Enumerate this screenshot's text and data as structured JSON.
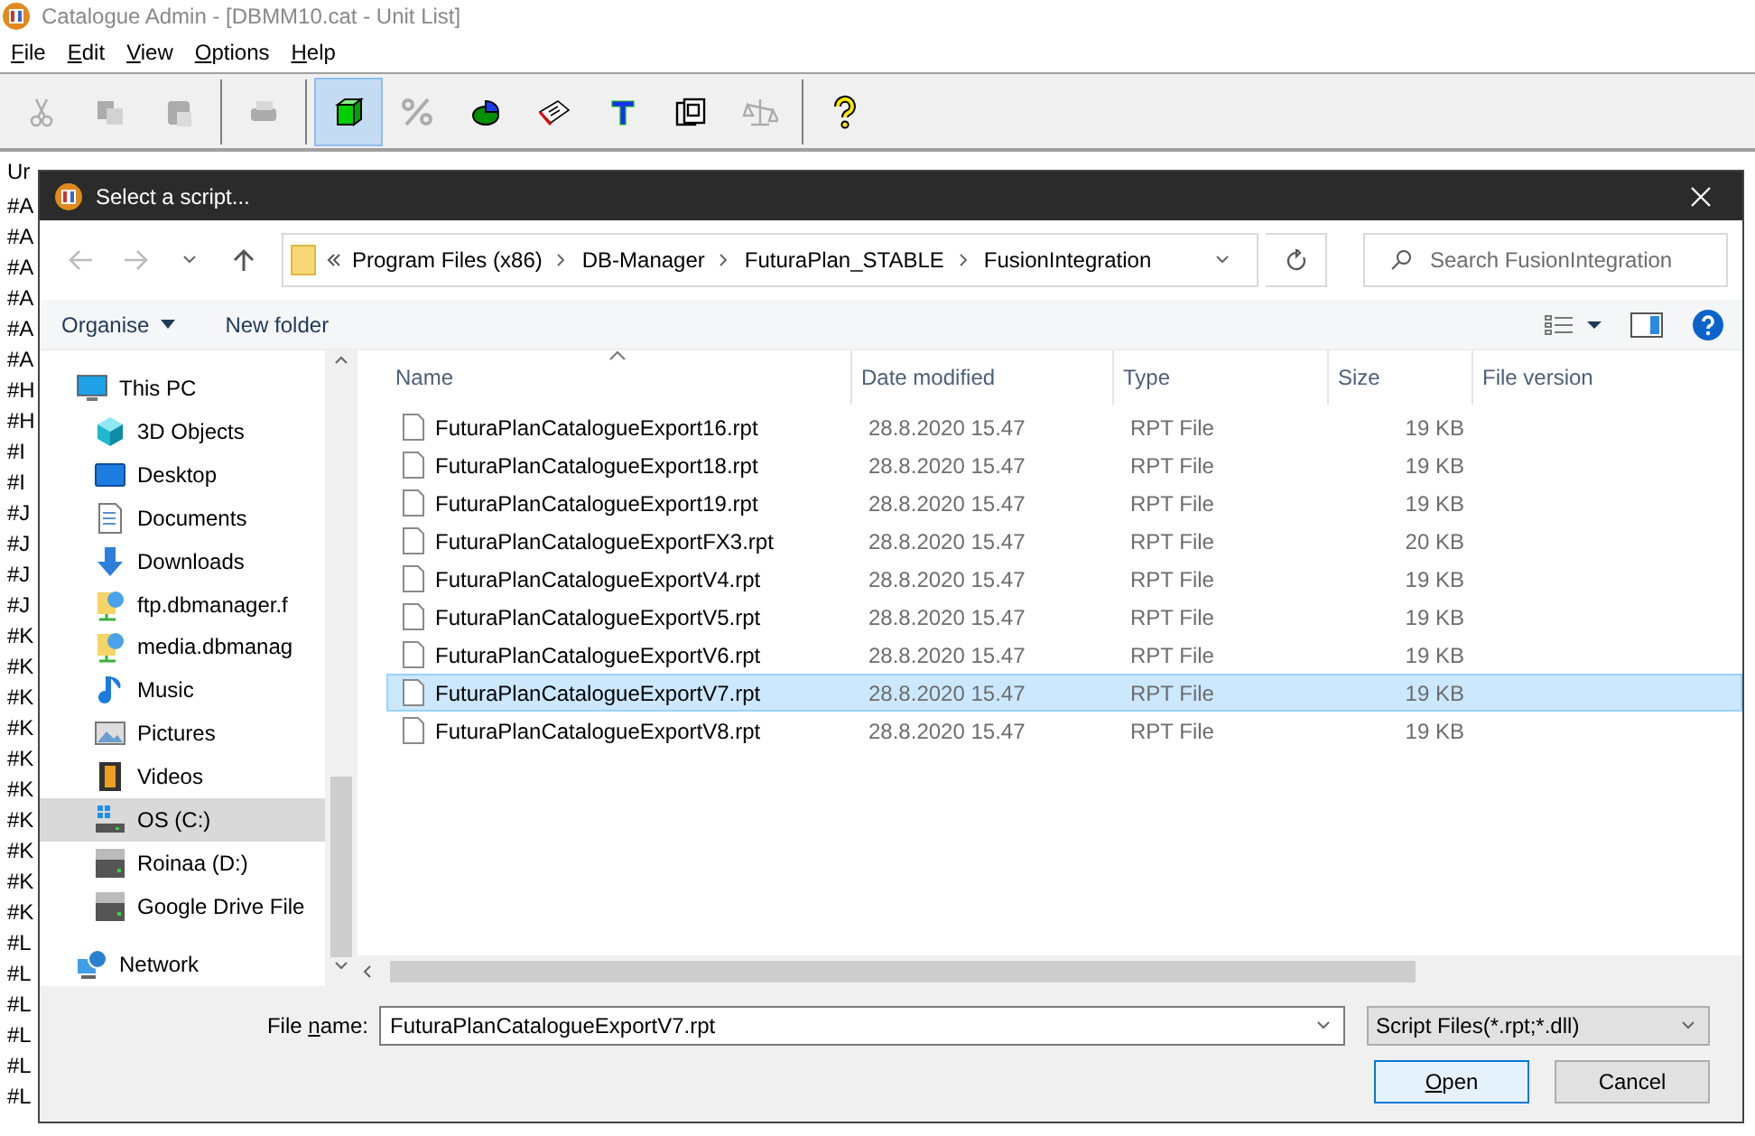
{
  "window": {
    "title": "Catalogue Admin - [DBMM10.cat - Unit List]"
  },
  "menu": [
    "File",
    "Edit",
    "View",
    "Options",
    "Help"
  ],
  "toolbar": [
    {
      "kind": "tool",
      "disabled": true,
      "selected": false
    },
    {
      "kind": "tool",
      "disabled": true,
      "selected": false
    },
    {
      "kind": "tool",
      "disabled": true,
      "selected": false
    },
    {
      "kind": "separator"
    },
    {
      "kind": "tool",
      "disabled": true,
      "selected": false
    },
    {
      "kind": "separator"
    },
    {
      "kind": "tool",
      "disabled": false,
      "selected": true
    },
    {
      "kind": "tool",
      "disabled": true,
      "selected": false
    },
    {
      "kind": "tool",
      "disabled": false,
      "selected": false
    },
    {
      "kind": "tool",
      "disabled": false,
      "selected": false
    },
    {
      "kind": "tool",
      "disabled": false,
      "selected": false
    },
    {
      "kind": "tool",
      "disabled": false,
      "selected": false
    },
    {
      "kind": "tool",
      "disabled": true,
      "selected": false
    },
    {
      "kind": "separator"
    },
    {
      "kind": "tool",
      "disabled": false,
      "selected": false
    }
  ],
  "unit_list": {
    "header": "Ur",
    "rows": [
      "#A",
      "#A",
      "#A",
      "#A",
      "#A",
      "#A",
      "#H",
      "#H",
      "#I",
      "#I",
      "#J",
      "#J",
      "#J",
      "#J",
      "#K",
      "#K",
      "#K",
      "#K",
      "#K",
      "#K",
      "#K",
      "#K",
      "#K",
      "#K",
      "#L",
      "#L",
      "#L",
      "#L",
      "#L",
      "#L"
    ]
  },
  "dialog": {
    "title": "Select a script...",
    "breadcrumb": [
      "Program Files (x86)",
      "DB-Manager",
      "FuturaPlan_STABLE",
      "FusionIntegration"
    ],
    "search": {
      "placeholder": "Search FusionIntegration"
    },
    "commands": [
      {
        "label": "Organise",
        "dropdown": true
      },
      {
        "label": "New folder",
        "dropdown": false
      }
    ],
    "nav": [
      {
        "label": "This PC",
        "selected": false,
        "children": [
          {
            "label": "3D Objects",
            "selected": false
          },
          {
            "label": "Desktop",
            "selected": false
          },
          {
            "label": "Documents",
            "selected": false
          },
          {
            "label": "Downloads",
            "selected": false
          },
          {
            "label": "ftp.dbmanager.f",
            "selected": false
          },
          {
            "label": "media.dbmanag",
            "selected": false
          },
          {
            "label": "Music",
            "selected": false
          },
          {
            "label": "Pictures",
            "selected": false
          },
          {
            "label": "Videos",
            "selected": false
          },
          {
            "label": "OS (C:)",
            "selected": true
          },
          {
            "label": "Roinaa (D:)",
            "selected": false
          },
          {
            "label": "Google Drive File",
            "selected": false
          }
        ]
      },
      {
        "label": "Network",
        "selected": false
      }
    ],
    "columns": [
      "Name",
      "Date modified",
      "Type",
      "Size",
      "File version"
    ],
    "files": [
      {
        "name": "FuturaPlanCatalogueExport16.rpt",
        "date": "28.8.2020 15.47",
        "type": "RPT File",
        "size": "19 KB",
        "selected": false
      },
      {
        "name": "FuturaPlanCatalogueExport18.rpt",
        "date": "28.8.2020 15.47",
        "type": "RPT File",
        "size": "19 KB",
        "selected": false
      },
      {
        "name": "FuturaPlanCatalogueExport19.rpt",
        "date": "28.8.2020 15.47",
        "type": "RPT File",
        "size": "19 KB",
        "selected": false
      },
      {
        "name": "FuturaPlanCatalogueExportFX3.rpt",
        "date": "28.8.2020 15.47",
        "type": "RPT File",
        "size": "20 KB",
        "selected": false
      },
      {
        "name": "FuturaPlanCatalogueExportV4.rpt",
        "date": "28.8.2020 15.47",
        "type": "RPT File",
        "size": "19 KB",
        "selected": false
      },
      {
        "name": "FuturaPlanCatalogueExportV5.rpt",
        "date": "28.8.2020 15.47",
        "type": "RPT File",
        "size": "19 KB",
        "selected": false
      },
      {
        "name": "FuturaPlanCatalogueExportV6.rpt",
        "date": "28.8.2020 15.47",
        "type": "RPT File",
        "size": "19 KB",
        "selected": false
      },
      {
        "name": "FuturaPlanCatalogueExportV7.rpt",
        "date": "28.8.2020 15.47",
        "type": "RPT File",
        "size": "19 KB",
        "selected": true
      },
      {
        "name": "FuturaPlanCatalogueExportV8.rpt",
        "date": "28.8.2020 15.47",
        "type": "RPT File",
        "size": "19 KB",
        "selected": false
      }
    ],
    "file_name_label": "File name:",
    "file_name": "FuturaPlanCatalogueExportV7.rpt",
    "file_type": "Script Files(*.rpt;*.dll)",
    "buttons": [
      {
        "label": "Open",
        "default": true
      },
      {
        "label": "Cancel",
        "default": false
      }
    ]
  }
}
